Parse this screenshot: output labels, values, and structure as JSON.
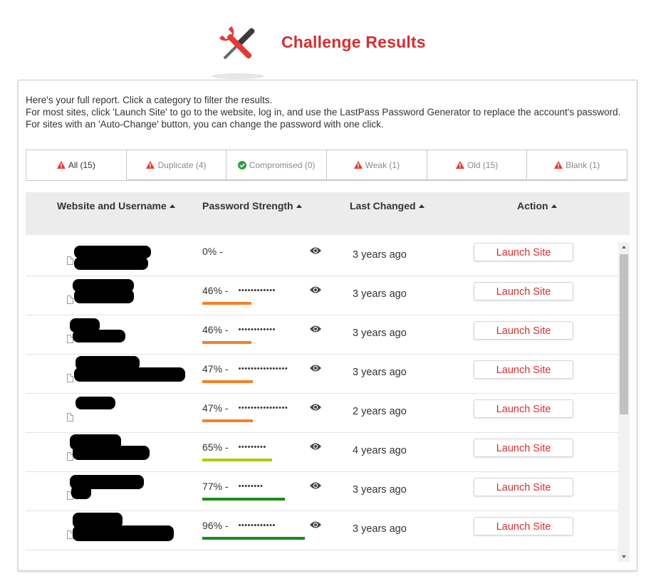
{
  "header": {
    "title": "Challenge Results",
    "logo_icon": "wrench-screwdriver-icon"
  },
  "intro": {
    "line1": "Here's your full report. Click a category to filter the results.",
    "line2": "For most sites, click 'Launch Site' to go to the website, log in, and use the LastPass Password Generator to replace the account's password. For sites with an 'Auto-Change' button, you can change the password with one click."
  },
  "filters": [
    {
      "label": "All (15)",
      "icon": "warning-icon",
      "active": true
    },
    {
      "label": "Duplicate (4)",
      "icon": "warning-icon",
      "active": false
    },
    {
      "label": "Compromised (0)",
      "icon": "check-circle-icon",
      "active": false
    },
    {
      "label": "Weak (1)",
      "icon": "warning-icon",
      "active": false
    },
    {
      "label": "Old (15)",
      "icon": "warning-icon",
      "active": false
    },
    {
      "label": "Blank (1)",
      "icon": "warning-icon",
      "active": false
    }
  ],
  "columns": {
    "site": "Website and Username",
    "strength": "Password Strength",
    "changed": "Last Changed",
    "action": "Action"
  },
  "rows": [
    {
      "strength": "0% -",
      "masked": "",
      "strength_value": 0,
      "bar_color": "#f58025",
      "changed": "3 years ago",
      "action": "Launch Site"
    },
    {
      "strength": "46% -",
      "masked": "••••••••••••",
      "strength_value": 46,
      "bar_color": "#f58025",
      "changed": "3 years ago",
      "action": "Launch Site"
    },
    {
      "strength": "46% -",
      "masked": "••••••••••••",
      "strength_value": 46,
      "bar_color": "#f58025",
      "changed": "3 years ago",
      "action": "Launch Site"
    },
    {
      "strength": "47% -",
      "masked": "••••••••••••••••",
      "strength_value": 47,
      "bar_color": "#f58025",
      "changed": "3 years ago",
      "action": "Launch Site"
    },
    {
      "strength": "47% -",
      "masked": "••••••••••••••••",
      "strength_value": 47,
      "bar_color": "#f58025",
      "changed": "2 years ago",
      "action": "Launch Site"
    },
    {
      "strength": "65% -",
      "masked": "•••••••••",
      "strength_value": 65,
      "bar_color": "#a6ce0c",
      "changed": "4 years ago",
      "action": "Launch Site"
    },
    {
      "strength": "77% -",
      "masked": "••••••••",
      "strength_value": 77,
      "bar_color": "#1b8a1b",
      "changed": "3 years ago",
      "action": "Launch Site"
    },
    {
      "strength": "96% -",
      "masked": "••••••••••••",
      "strength_value": 96,
      "bar_color": "#1b8a1b",
      "changed": "3 years ago",
      "action": "Launch Site"
    }
  ],
  "colors": {
    "accent": "#d32f2f",
    "header_bg": "#ececec",
    "weak": "#f58025",
    "medium": "#a6ce0c",
    "strong": "#1b8a1b"
  }
}
